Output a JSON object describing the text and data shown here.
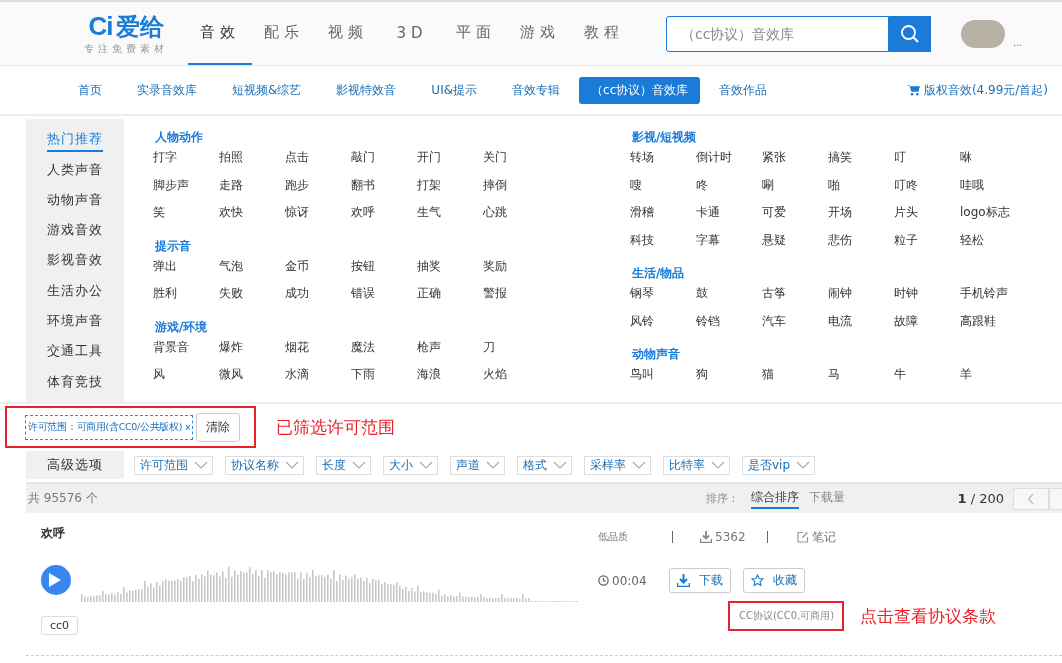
{
  "header": {
    "logo": {
      "mark": "Ci",
      "name": "爱给",
      "tagline": "专注免费素材"
    },
    "main_nav": [
      {
        "label": "音效",
        "selected": true
      },
      {
        "label": "配乐",
        "selected": false
      },
      {
        "label": "视频",
        "selected": false
      },
      {
        "label": "3D",
        "selected": false
      },
      {
        "label": "平面",
        "selected": false
      },
      {
        "label": "游戏",
        "selected": false
      },
      {
        "label": "教程",
        "selected": false
      }
    ],
    "search": {
      "placeholder": "（cc协议）音效库"
    },
    "user": {
      "more": "..."
    }
  },
  "sub_nav": {
    "items": [
      {
        "label": "首页",
        "selected": false
      },
      {
        "label": "实录音效库",
        "selected": false
      },
      {
        "label": "短视频&综艺",
        "selected": false
      },
      {
        "label": "影视特效音",
        "selected": false
      },
      {
        "label": "UI&提示",
        "selected": false
      },
      {
        "label": "音效专辑",
        "selected": false
      },
      {
        "label": "（cc协议）音效库",
        "selected": true
      },
      {
        "label": "音效作品",
        "selected": false
      }
    ],
    "cart_link": "版权音效(4.99元/首起)"
  },
  "categories": {
    "sidebar": [
      {
        "label": "热门推荐",
        "selected": true
      },
      {
        "label": "人类声音",
        "selected": false
      },
      {
        "label": "动物声音",
        "selected": false
      },
      {
        "label": "游戏音效",
        "selected": false
      },
      {
        "label": "影视音效",
        "selected": false
      },
      {
        "label": "生活办公",
        "selected": false
      },
      {
        "label": "环境声音",
        "selected": false
      },
      {
        "label": "交通工具",
        "selected": false
      },
      {
        "label": "体育竞技",
        "selected": false
      }
    ],
    "columns": [
      [
        {
          "title": "人物动作",
          "items": [
            "打字",
            "拍照",
            "点击",
            "敲门",
            "开门",
            "关门",
            "脚步声",
            "走路",
            "跑步",
            "翻书",
            "打架",
            "摔倒",
            "笑",
            "欢快",
            "惊讶",
            "欢呼",
            "生气",
            "心跳"
          ]
        },
        {
          "title": "提示音",
          "items": [
            "弹出",
            "气泡",
            "金币",
            "按钮",
            "抽奖",
            "奖励",
            "胜利",
            "失败",
            "成功",
            "错误",
            "正确",
            "警报"
          ]
        },
        {
          "title": "游戏/环境",
          "items": [
            "背景音",
            "爆炸",
            "烟花",
            "魔法",
            "枪声",
            "刀",
            "风",
            "微风",
            "水滴",
            "下雨",
            "海浪",
            "火焰"
          ]
        }
      ],
      [
        {
          "title": "影视/短视频",
          "items": [
            "转场",
            "倒计时",
            "紧张",
            "搞笑",
            "叮",
            "咻",
            "嗖",
            "咚",
            "唰",
            "啪",
            "叮咚",
            "哇哦",
            "滑稽",
            "卡通",
            "可爱",
            "开场",
            "片头",
            "logo标志",
            "科技",
            "字幕",
            "悬疑",
            "悲伤",
            "粒子",
            "轻松"
          ]
        },
        {
          "title": "生活/物品",
          "items": [
            "钢琴",
            "鼓",
            "古筝",
            "闹钟",
            "时钟",
            "手机铃声",
            "风铃",
            "铃铛",
            "汽车",
            "电流",
            "故障",
            "高跟鞋"
          ]
        },
        {
          "title": "动物声音",
          "items": [
            "鸟叫",
            "狗",
            "猫",
            "马",
            "牛",
            "羊"
          ]
        }
      ]
    ]
  },
  "filters": {
    "active_filter": "许可范围：可商用(含CC0/公共版权) x",
    "clear_button": "清除",
    "annotation": "已筛选许可范围",
    "advanced_label": "高级选项",
    "dropdowns": [
      "许可范围",
      "协议名称",
      "长度",
      "大小",
      "声道",
      "格式",
      "采样率",
      "比特率",
      "是否vip"
    ]
  },
  "results_bar": {
    "count": "共 95576 个",
    "sort_label": "排序：",
    "sort_options": [
      {
        "label": "综合排序",
        "selected": true
      },
      {
        "label": "下载量",
        "selected": false
      }
    ],
    "page": "1",
    "total_pages": "/ 200"
  },
  "result": {
    "title": "欢呼",
    "quality": "低品质",
    "downloads": "5362",
    "note": "笔记",
    "duration": "00:04",
    "download_button": "下载",
    "favorite_button": "收藏",
    "tag": "cc0",
    "license": "CC协议(CC0,可商用)",
    "annotation": "点击查看协议条款"
  }
}
